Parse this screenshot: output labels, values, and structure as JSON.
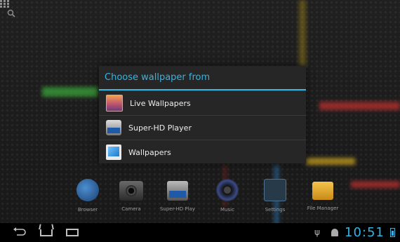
{
  "dialog": {
    "title": "Choose wallpaper from",
    "options": [
      {
        "label": "Live Wallpapers",
        "icon": "live-wallpapers-icon"
      },
      {
        "label": "Super-HD Player",
        "icon": "super-hd-player-icon"
      },
      {
        "label": "Wallpapers",
        "icon": "wallpapers-icon"
      }
    ]
  },
  "dock": {
    "apps": [
      {
        "label": "Browser",
        "icon": "globe-icon"
      },
      {
        "label": "Camera",
        "icon": "camera-icon"
      },
      {
        "label": "Super-HD Play",
        "icon": "hd-player-icon"
      },
      {
        "label": "Music",
        "icon": "speaker-icon"
      },
      {
        "label": "Settings",
        "icon": "settings-icon"
      },
      {
        "label": "File Manager",
        "icon": "folder-icon"
      }
    ]
  },
  "status": {
    "clock": "10:51",
    "accent": "#33b5e5"
  }
}
